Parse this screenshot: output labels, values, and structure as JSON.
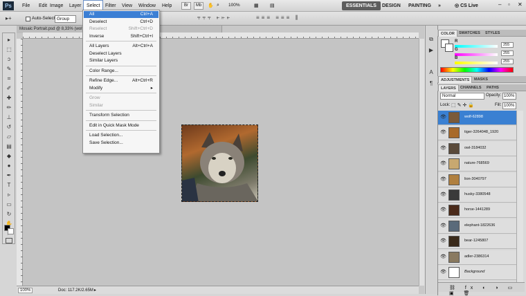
{
  "app": {
    "logo": "Ps"
  },
  "menubar": {
    "items": [
      "File",
      "Edit",
      "Image",
      "Layer",
      "Select",
      "Filter",
      "View",
      "Window",
      "Help"
    ],
    "buttons": [
      "Br",
      "Mb"
    ],
    "zoom": "100%",
    "workspaces": [
      "ESSENTIALS",
      "DESIGN",
      "PAINTING"
    ],
    "more": "»",
    "cslive": "CS Live"
  },
  "options_bar": {
    "auto_select_label": "Auto-Select:",
    "auto_select_value": "Group"
  },
  "document": {
    "tab_title": "Mosaic Portrait.psd @ 8,33% (wolf-62898, RGB/8) *",
    "zoom": "100%",
    "doc_info": "Doc: 117.2K/2.65M"
  },
  "select_menu": {
    "items": [
      {
        "label": "All",
        "shortcut": "Ctrl+A",
        "state": "highlight"
      },
      {
        "label": "Deselect",
        "shortcut": "Ctrl+D",
        "state": "normal"
      },
      {
        "label": "Reselect",
        "shortcut": "Shift+Ctrl+D",
        "state": "disabled"
      },
      {
        "label": "Inverse",
        "shortcut": "Shift+Ctrl+I",
        "state": "normal"
      },
      {
        "sep": true
      },
      {
        "label": "All Layers",
        "shortcut": "Alt+Ctrl+A",
        "state": "normal"
      },
      {
        "label": "Deselect Layers",
        "shortcut": "",
        "state": "normal"
      },
      {
        "label": "Similar Layers",
        "shortcut": "",
        "state": "normal"
      },
      {
        "sep": true
      },
      {
        "label": "Color Range...",
        "shortcut": "",
        "state": "normal"
      },
      {
        "sep": true
      },
      {
        "label": "Refine Edge...",
        "shortcut": "Alt+Ctrl+R",
        "state": "normal"
      },
      {
        "label": "Modify",
        "shortcut": "▸",
        "state": "normal"
      },
      {
        "sep": true
      },
      {
        "label": "Grow",
        "shortcut": "",
        "state": "disabled"
      },
      {
        "label": "Similar",
        "shortcut": "",
        "state": "disabled"
      },
      {
        "sep": true
      },
      {
        "label": "Transform Selection",
        "shortcut": "",
        "state": "normal"
      },
      {
        "sep": true
      },
      {
        "label": "Edit in Quick Mask Mode",
        "shortcut": "",
        "state": "normal"
      },
      {
        "sep": true
      },
      {
        "label": "Load Selection...",
        "shortcut": "",
        "state": "normal"
      },
      {
        "label": "Save Selection...",
        "shortcut": "",
        "state": "normal"
      }
    ]
  },
  "color_panel": {
    "tabs": [
      "COLOR",
      "SWATCHES",
      "STYLES"
    ],
    "channels": [
      {
        "label": "R",
        "value": "255",
        "color": "#e03a3a"
      },
      {
        "label": "G",
        "value": "255",
        "color": "#e040e0"
      },
      {
        "label": "B",
        "value": "255",
        "color": "#e8e040"
      }
    ]
  },
  "adjust_panel": {
    "tabs": [
      "ADJUSTMENTS",
      "MASKS"
    ]
  },
  "layers_panel": {
    "tabs": [
      "LAYERS",
      "CHANNELS",
      "PATHS"
    ],
    "blend_mode": "Normal",
    "opacity_label": "Opacity:",
    "opacity": "100%",
    "lock_label": "Lock:",
    "fill_label": "Fill:",
    "fill": "100%",
    "layers": [
      {
        "name": "wolf-62898",
        "selected": true,
        "color": "#7a5a3a"
      },
      {
        "name": "tiger-3264048_1920",
        "selected": false,
        "color": "#a86a2a"
      },
      {
        "name": "owl-3184032",
        "selected": false,
        "color": "#5a4a3a"
      },
      {
        "name": "nature-768569",
        "selected": false,
        "color": "#c8a870"
      },
      {
        "name": "lion-3040797",
        "selected": false,
        "color": "#b08040"
      },
      {
        "name": "husky-3380548",
        "selected": false,
        "color": "#3a3a3a"
      },
      {
        "name": "horse-1441289",
        "selected": false,
        "color": "#4a2a1a"
      },
      {
        "name": "elephant-1822636",
        "selected": false,
        "color": "#5a6a7a"
      },
      {
        "name": "bear-1245807",
        "selected": false,
        "color": "#3a2a1a"
      },
      {
        "name": "adler-2386314",
        "selected": false,
        "color": "#8a7a60"
      },
      {
        "name": "Background",
        "selected": false,
        "color": "#ffffff"
      }
    ]
  }
}
